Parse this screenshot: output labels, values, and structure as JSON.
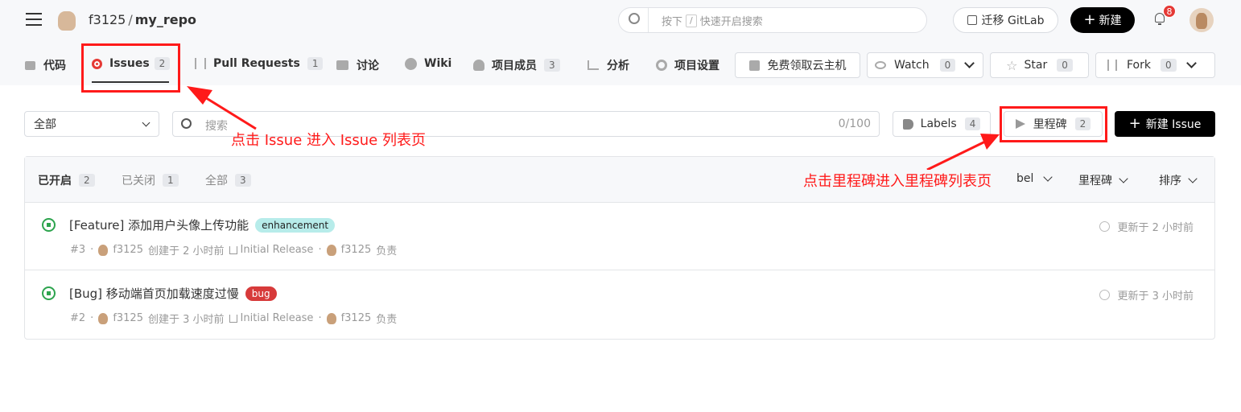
{
  "header": {
    "owner": "f3125",
    "separator": "/",
    "repo": "my_repo",
    "search_shortcut_prefix": "按下",
    "search_shortcut_key": "/",
    "search_placeholder": "快速开启搜索",
    "migrate_label": "迁移 GitLab",
    "new_label": "新建",
    "notification_count": "8"
  },
  "nav": {
    "code": "代码",
    "issues": "Issues",
    "issues_count": "2",
    "pulls": "Pull Requests",
    "pulls_count": "1",
    "discuss": "讨论",
    "wiki": "Wiki",
    "members": "项目成员",
    "members_count": "3",
    "analytics": "分析",
    "settings": "项目设置",
    "cloud": "免费领取云主机",
    "watch": "Watch",
    "watch_count": "0",
    "star": "Star",
    "star_count": "0",
    "fork": "Fork",
    "fork_count": "0"
  },
  "filter": {
    "scope": "全部",
    "search_placeholder": "搜索",
    "char_count": "0/100",
    "labels": "Labels",
    "labels_count": "4",
    "milestone": "里程碑",
    "milestone_count": "2",
    "new_issue": "新建 Issue"
  },
  "tabs": {
    "open": "已开启",
    "open_count": "2",
    "closed": "已关闭",
    "closed_count": "1",
    "all": "全部",
    "all_count": "3",
    "label_filter": "bel",
    "milestone_filter": "里程碑",
    "sort": "排序"
  },
  "issues": [
    {
      "title": "[Feature] 添加用户头像上传功能",
      "label": "enhancement",
      "label_color": "#b7ecea",
      "number": "#3",
      "author": "f3125",
      "created": "创建于 2 小时前",
      "milestone": "Initial Release",
      "assignee": "f3125",
      "assignee_role": "负责",
      "updated": "更新于 2 小时前"
    },
    {
      "title": "[Bug] 移动端首页加载速度过慢",
      "label": "bug",
      "label_color": "#d73a3a",
      "number": "#2",
      "author": "f3125",
      "created": "创建于 3 小时前",
      "milestone": "Initial Release",
      "assignee": "f3125",
      "assignee_role": "负责",
      "updated": "更新于 3 小时前"
    }
  ],
  "annotations": {
    "issue_hint": "点击 Issue 进入 Issue 列表页",
    "milestone_hint": "点击里程碑进入里程碑列表页"
  },
  "colors": {
    "annotation_red": "#ff1a1a",
    "issue_active_red": "#e53935",
    "open_green": "#2da44e"
  }
}
